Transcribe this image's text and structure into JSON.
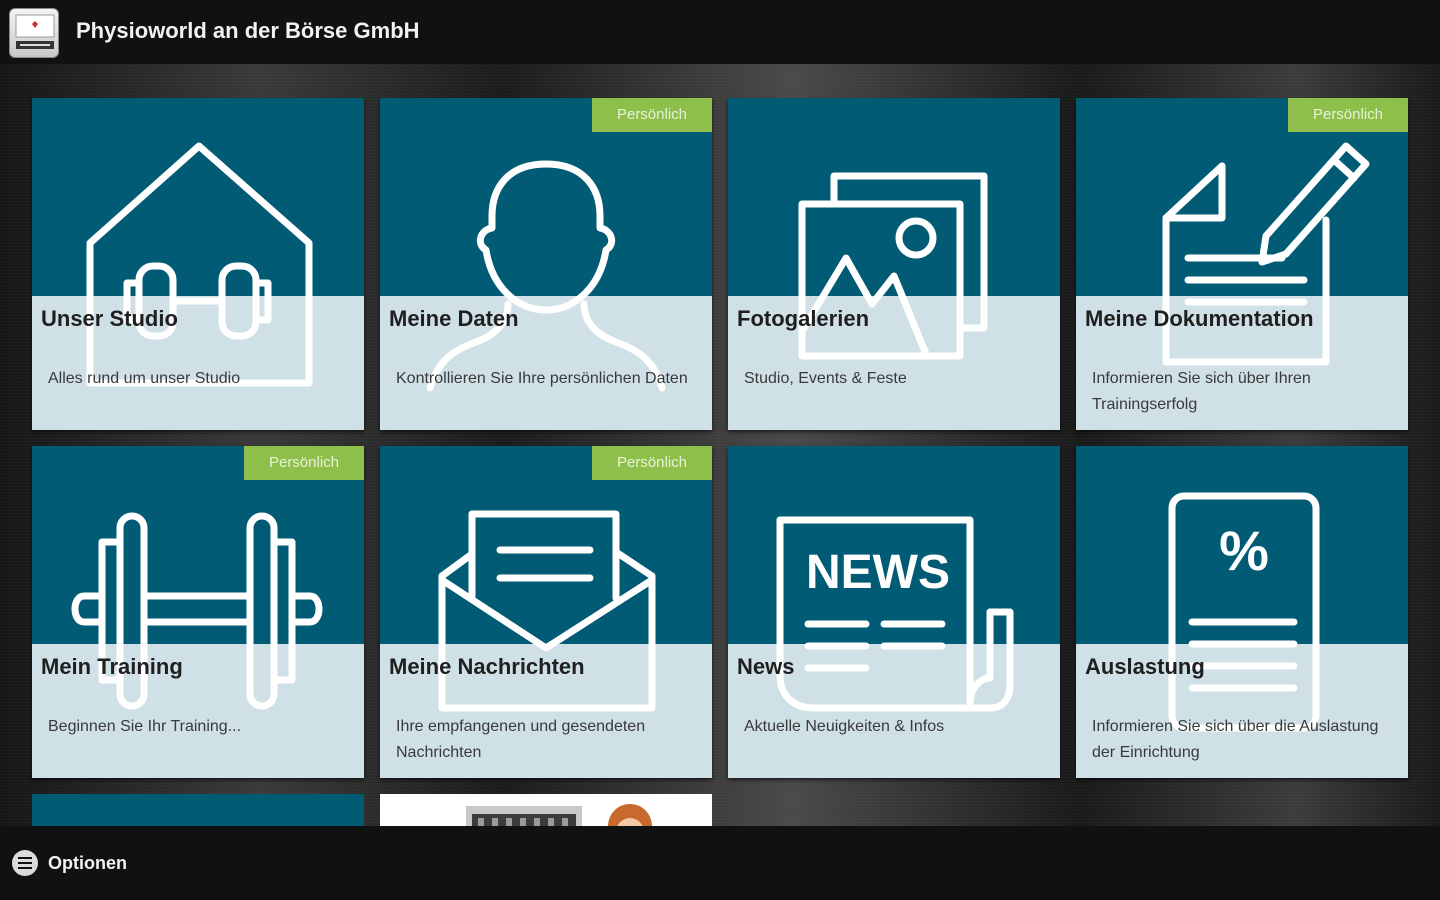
{
  "header": {
    "title": "Physioworld an der Börse GmbH",
    "app_icon": "app-logo-icon"
  },
  "colors": {
    "tile_top": "#015b75",
    "tile_bottom": "#cfe0e6",
    "badge": "#8dbf4a",
    "bar": "#111111"
  },
  "tiles": [
    {
      "title": "Unser Studio",
      "description": "Alles rund um unser Studio",
      "badge": "",
      "icon": "house-dumbbell-icon"
    },
    {
      "title": "Meine Daten",
      "description": "Kontrollieren Sie Ihre persönlichen Daten",
      "badge": "Persönlich",
      "icon": "person-icon"
    },
    {
      "title": "Fotogalerien",
      "description": "Studio, Events & Feste",
      "badge": "",
      "icon": "gallery-icon"
    },
    {
      "title": "Meine Dokumentation",
      "description": "Informieren Sie sich über Ihren Trainingserfolg",
      "badge": "Persönlich",
      "icon": "document-pen-icon"
    },
    {
      "title": "Mein Training",
      "description": "Beginnen Sie Ihr Training...",
      "badge": "Persönlich",
      "icon": "barbell-icon"
    },
    {
      "title": "Meine Nachrichten",
      "description": "Ihre empfangenen und gesendeten Nachrichten",
      "badge": "Persönlich",
      "icon": "envelope-icon"
    },
    {
      "title": "News",
      "description": "Aktuelle Neuigkeiten & Infos",
      "badge": "",
      "icon": "newspaper-icon",
      "icon_text": "NEWS"
    },
    {
      "title": "Auslastung",
      "description": "Informieren Sie sich über die Auslastung der Einrichtung",
      "badge": "",
      "icon": "percent-document-icon",
      "icon_text": "%"
    }
  ],
  "footer": {
    "options_label": "Optionen",
    "options_icon": "menu-icon"
  }
}
